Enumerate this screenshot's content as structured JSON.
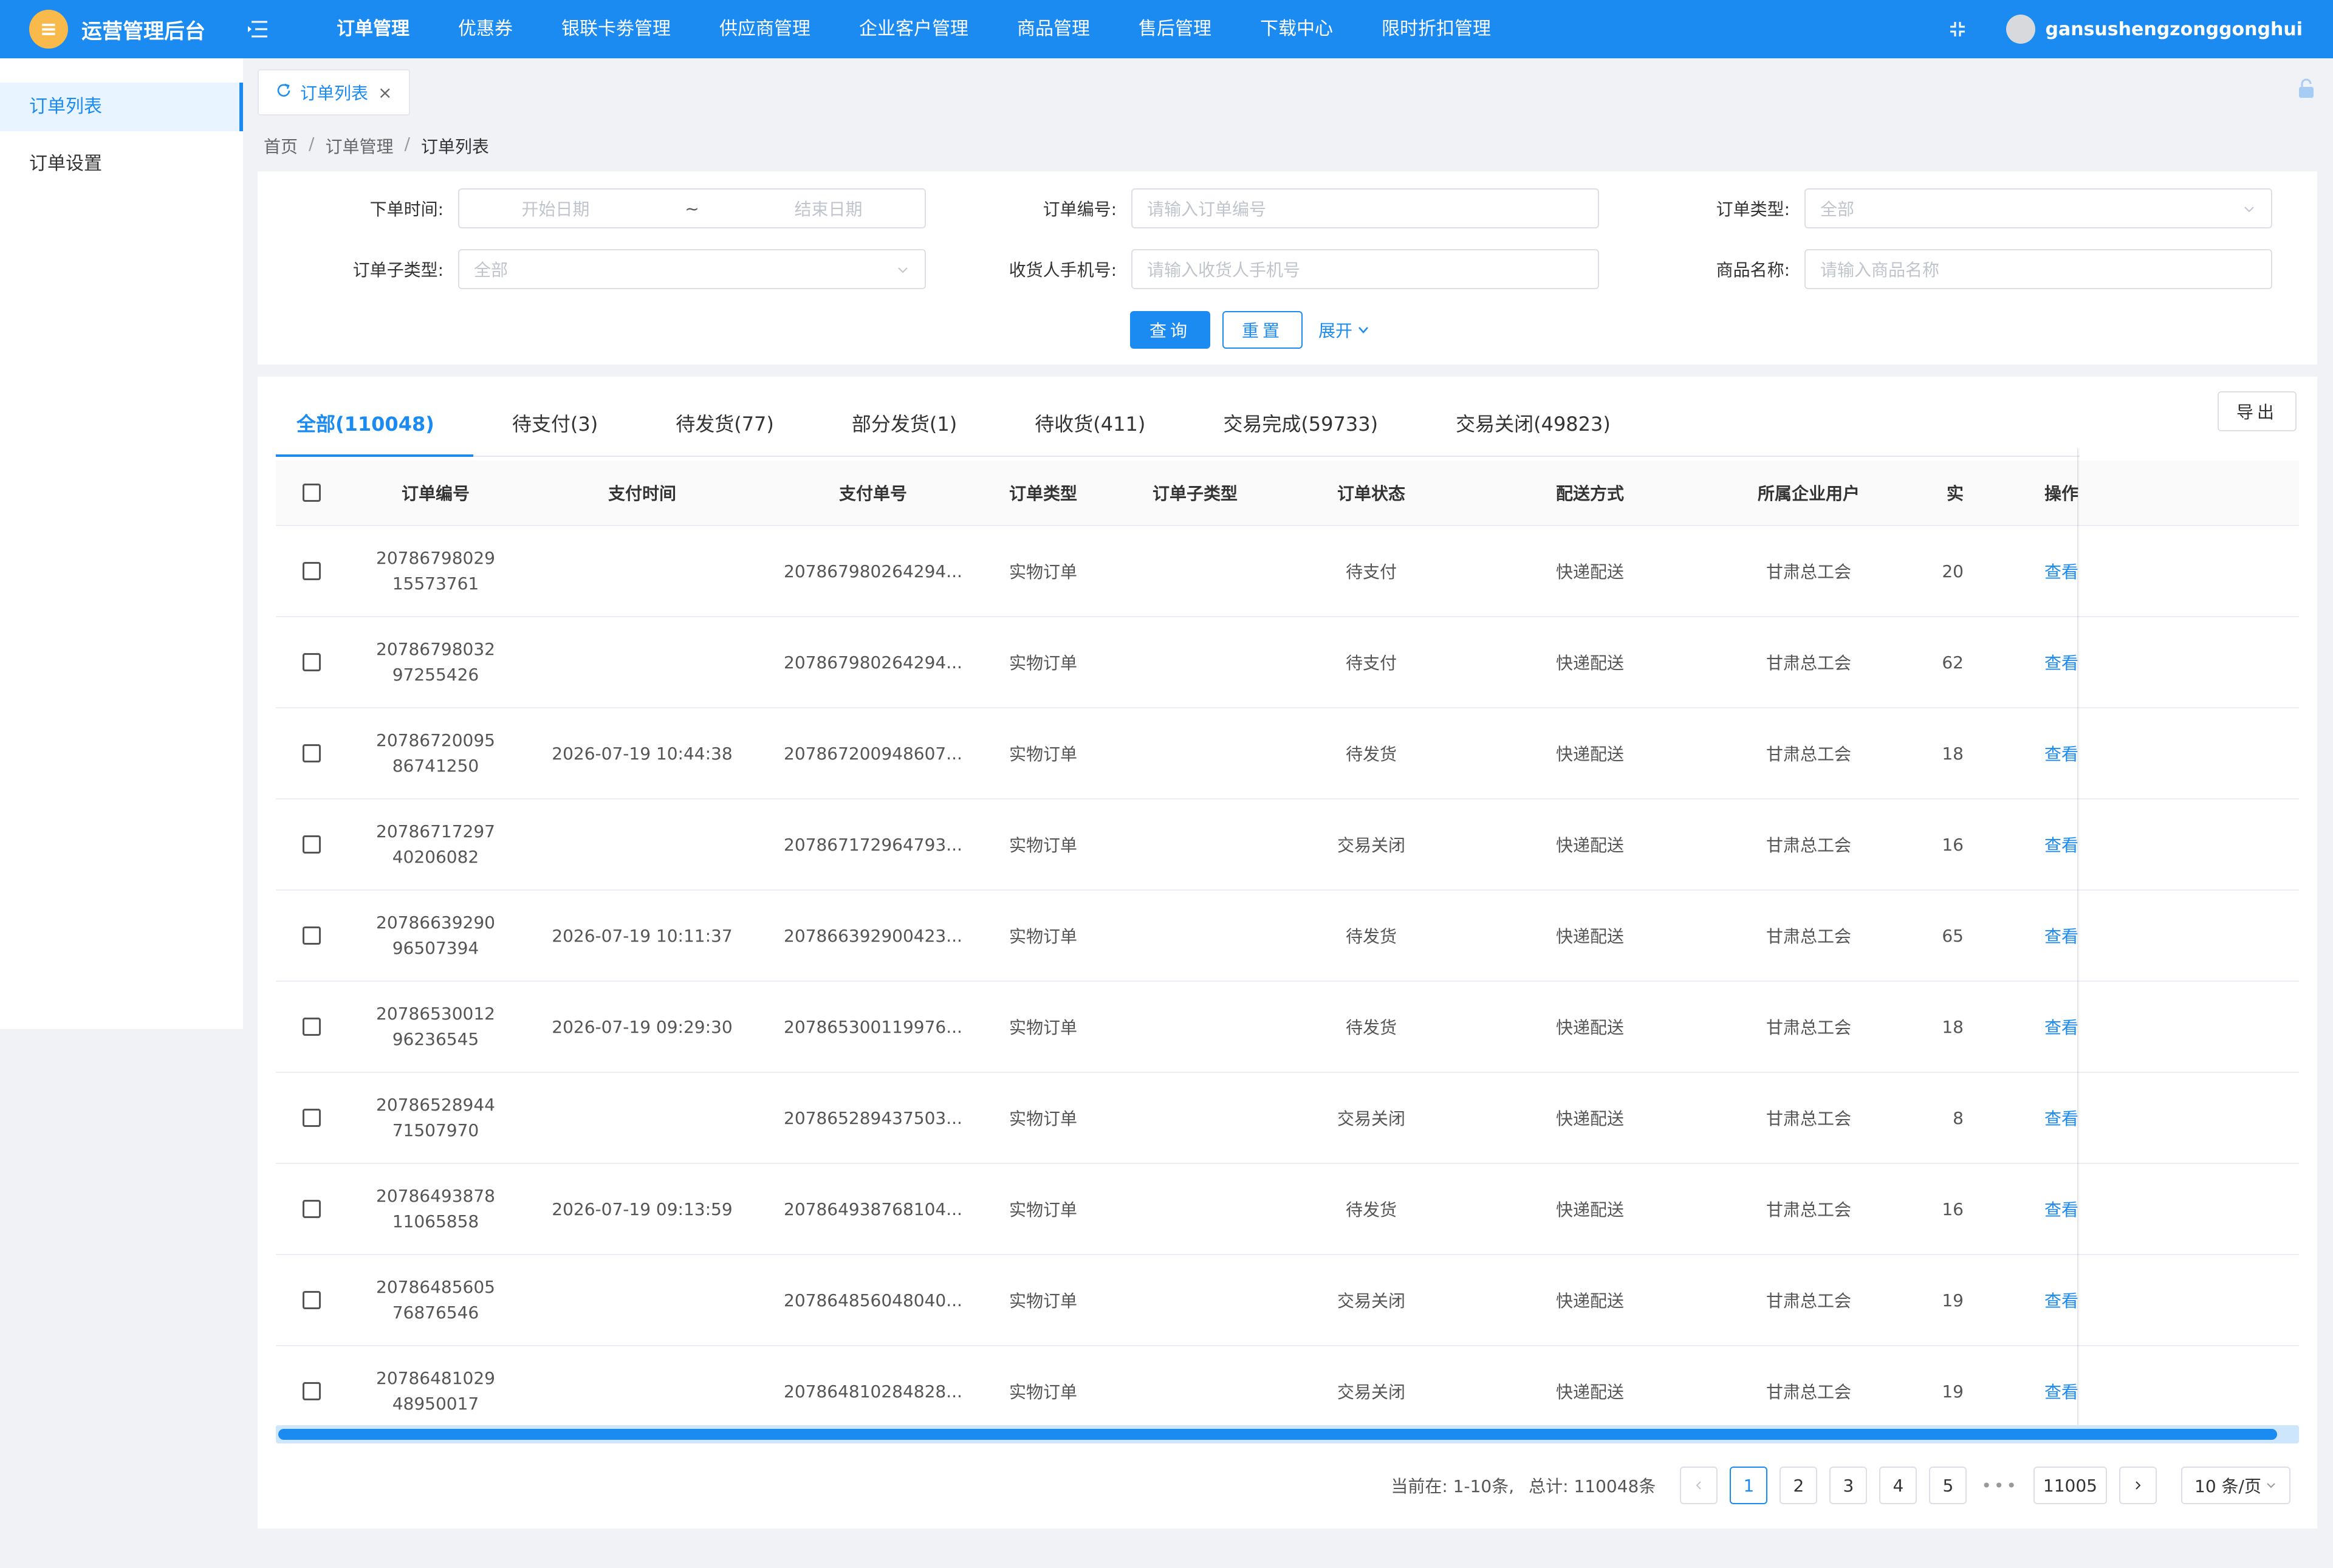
{
  "app": {
    "title": "运营管理后台",
    "logo_glyph": "≡",
    "brand_color": "#1c8bf1",
    "accent_logo_color": "#f9b94b"
  },
  "topnav": {
    "items": [
      {
        "label": "订单管理",
        "active": true
      },
      {
        "label": "优惠券"
      },
      {
        "label": "银联卡劵管理"
      },
      {
        "label": "供应商管理"
      },
      {
        "label": "企业客户管理"
      },
      {
        "label": "商品管理"
      },
      {
        "label": "售后管理"
      },
      {
        "label": "下载中心"
      },
      {
        "label": "限时折扣管理"
      }
    ],
    "username": "gansushengzonggonghui"
  },
  "sidebar": {
    "items": [
      {
        "label": "订单列表",
        "active": true
      },
      {
        "label": "订单设置"
      }
    ]
  },
  "page_tab": {
    "label": "订单列表",
    "close": "×"
  },
  "breadcrumb": {
    "items": [
      "首页",
      "订单管理",
      "订单列表"
    ],
    "separator": "/"
  },
  "search": {
    "order_time_label": "下单时间:",
    "start_placeholder": "开始日期",
    "range_sep": "~",
    "end_placeholder": "结束日期",
    "order_no_label": "订单编号:",
    "order_no_placeholder": "请输入订单编号",
    "order_type_label": "订单类型:",
    "order_type_value": "全部",
    "order_subtype_label": "订单子类型:",
    "order_subtype_value": "全部",
    "phone_label": "收货人手机号:",
    "phone_placeholder": "请输入收货人手机号",
    "product_label": "商品名称:",
    "product_placeholder": "请输入商品名称",
    "query_btn": "查询",
    "reset_btn": "重置",
    "expand_link": "展开"
  },
  "status_tabs": [
    {
      "label": "全部(110048)",
      "active": true
    },
    {
      "label": "待支付(3)"
    },
    {
      "label": "待发货(77)"
    },
    {
      "label": "部分发货(1)"
    },
    {
      "label": "待收货(411)"
    },
    {
      "label": "交易完成(59733)"
    },
    {
      "label": "交易关闭(49823)"
    }
  ],
  "export_btn": "导出",
  "table": {
    "headers": {
      "order_no": "订单编号",
      "pay_time": "支付时间",
      "pay_no": "支付单号",
      "order_type": "订单类型",
      "order_subtype": "订单子类型",
      "status": "订单状态",
      "delivery": "配送方式",
      "company": "所属企业用户",
      "amount": "实",
      "op": "操作"
    },
    "rows": [
      {
        "order_no": "2078679802915573761",
        "pay_time": "",
        "pay_no": "207867980264294...",
        "order_type": "实物订单",
        "order_subtype": "",
        "status": "待支付",
        "delivery": "快递配送",
        "company": "甘肃总工会",
        "amount": "20",
        "op": "查看"
      },
      {
        "order_no": "2078679803297255426",
        "pay_time": "",
        "pay_no": "207867980264294...",
        "order_type": "实物订单",
        "order_subtype": "",
        "status": "待支付",
        "delivery": "快递配送",
        "company": "甘肃总工会",
        "amount": "62",
        "op": "查看"
      },
      {
        "order_no": "2078672009586741250",
        "pay_time": "2026-07-19 10:44:38",
        "pay_no": "207867200948607...",
        "order_type": "实物订单",
        "order_subtype": "",
        "status": "待发货",
        "delivery": "快递配送",
        "company": "甘肃总工会",
        "amount": "18",
        "op": "查看"
      },
      {
        "order_no": "2078671729740206082",
        "pay_time": "",
        "pay_no": "207867172964793...",
        "order_type": "实物订单",
        "order_subtype": "",
        "status": "交易关闭",
        "delivery": "快递配送",
        "company": "甘肃总工会",
        "amount": "16",
        "op": "查看"
      },
      {
        "order_no": "2078663929096507394",
        "pay_time": "2026-07-19 10:11:37",
        "pay_no": "207866392900423...",
        "order_type": "实物订单",
        "order_subtype": "",
        "status": "待发货",
        "delivery": "快递配送",
        "company": "甘肃总工会",
        "amount": "65",
        "op": "查看"
      },
      {
        "order_no": "2078653001296236545",
        "pay_time": "2026-07-19 09:29:30",
        "pay_no": "207865300119976...",
        "order_type": "实物订单",
        "order_subtype": "",
        "status": "待发货",
        "delivery": "快递配送",
        "company": "甘肃总工会",
        "amount": "18",
        "op": "查看"
      },
      {
        "order_no": "2078652894471507970",
        "pay_time": "",
        "pay_no": "207865289437503...",
        "order_type": "实物订单",
        "order_subtype": "",
        "status": "交易关闭",
        "delivery": "快递配送",
        "company": "甘肃总工会",
        "amount": "8",
        "op": "查看"
      },
      {
        "order_no": "2078649387811065858",
        "pay_time": "2026-07-19 09:13:59",
        "pay_no": "207864938768104...",
        "order_type": "实物订单",
        "order_subtype": "",
        "status": "待发货",
        "delivery": "快递配送",
        "company": "甘肃总工会",
        "amount": "16",
        "op": "查看"
      },
      {
        "order_no": "2078648560576876546",
        "pay_time": "",
        "pay_no": "207864856048040...",
        "order_type": "实物订单",
        "order_subtype": "",
        "status": "交易关闭",
        "delivery": "快递配送",
        "company": "甘肃总工会",
        "amount": "19",
        "op": "查看"
      },
      {
        "order_no": "2078648102948950017",
        "pay_time": "",
        "pay_no": "207864810284828...",
        "order_type": "实物订单",
        "order_subtype": "",
        "status": "交易关闭",
        "delivery": "快递配送",
        "company": "甘肃总工会",
        "amount": "19",
        "op": "查看"
      }
    ]
  },
  "pagination": {
    "current_text": "当前在: 1-10条,",
    "total_text": "总计: 110048条",
    "pages": [
      "1",
      "2",
      "3",
      "4",
      "5"
    ],
    "ellipsis": "•••",
    "last_page": "11005",
    "page_size": "10 条/页"
  }
}
